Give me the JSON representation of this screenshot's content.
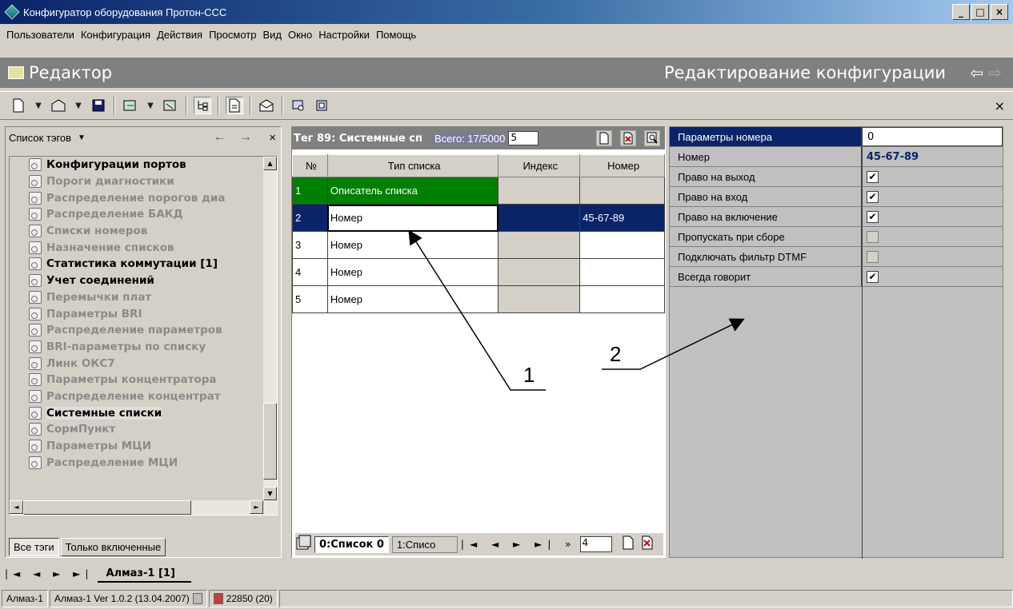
{
  "window": {
    "title": "Конфигуратор оборудования Протон-ССС",
    "buttons": [
      "_",
      "□",
      "×"
    ]
  },
  "menu": [
    "Пользователи",
    "Конфигурация",
    "Действия",
    "Просмотр",
    "Вид",
    "Окно",
    "Настройки",
    "Помощь"
  ],
  "editor": {
    "title": "Редактор",
    "subtitle": "Редактирование конфигурации",
    "back_arrow": "⇦",
    "forward_arrow": "⇨"
  },
  "toolbar": {
    "close": "×"
  },
  "left": {
    "header": "Список тэгов",
    "dropdown": "▼",
    "nav": "← →",
    "close": "×",
    "items": [
      {
        "label": "Конфигурации портов",
        "enabled": true
      },
      {
        "label": "Пороги диагностики",
        "enabled": false
      },
      {
        "label": "Распределение порогов диа",
        "enabled": false
      },
      {
        "label": "Распределение БАКД",
        "enabled": false
      },
      {
        "label": "Списки номеров",
        "enabled": false
      },
      {
        "label": "Назначение списков",
        "enabled": false
      },
      {
        "label": "Статистика коммутации [1]",
        "enabled": true
      },
      {
        "label": "Учет соединений",
        "enabled": true
      },
      {
        "label": "Перемычки плат",
        "enabled": false
      },
      {
        "label": "Параметры BRI",
        "enabled": false
      },
      {
        "label": "Распределение параметров",
        "enabled": false
      },
      {
        "label": "BRI-параметры по списку",
        "enabled": false
      },
      {
        "label": "Линк ОКС7",
        "enabled": false
      },
      {
        "label": "Параметры концентратора",
        "enabled": false
      },
      {
        "label": "Распределение концентрат",
        "enabled": false
      },
      {
        "label": "Системные списки",
        "enabled": true,
        "selected": true
      },
      {
        "label": "СормПункт",
        "enabled": false
      },
      {
        "label": "Параметры МЦИ",
        "enabled": false
      },
      {
        "label": "Распределение МЦИ",
        "enabled": false
      }
    ],
    "tabs": [
      "Все тэги",
      "Только включенные"
    ]
  },
  "middle": {
    "tag_title": "Тег 89: Системные сп",
    "total": "Всего: 17/5000",
    "count": "5",
    "columns": [
      "№",
      "Тип списка",
      "Индекс",
      "Номер"
    ],
    "rows": [
      {
        "n": "1",
        "type": "Описатель списка",
        "index": "",
        "number": ""
      },
      {
        "n": "2",
        "type": "Номер",
        "index": "",
        "number": "45-67-89"
      },
      {
        "n": "3",
        "type": "Номер",
        "index": "",
        "number": ""
      },
      {
        "n": "4",
        "type": "Номер",
        "index": "",
        "number": ""
      },
      {
        "n": "5",
        "type": "Номер",
        "index": "",
        "number": ""
      }
    ],
    "footer": {
      "tab_active": "0:Список 0",
      "tab_next": "1:Списо",
      "nav": "|◄ ◄ ► ►| »",
      "page": "4"
    }
  },
  "right": {
    "rows": [
      {
        "label": "Параметры номера",
        "value": "0",
        "kind": "input"
      },
      {
        "label": "Номер",
        "value": "45-67-89",
        "kind": "text"
      },
      {
        "label": "Право на выход",
        "checked": true,
        "kind": "check"
      },
      {
        "label": "Право на вход",
        "checked": true,
        "kind": "check"
      },
      {
        "label": "Право на включение",
        "checked": true,
        "kind": "check"
      },
      {
        "label": "Пропускать при сборе",
        "checked": false,
        "kind": "check"
      },
      {
        "label": "Подключать фильтр DTMF",
        "checked": false,
        "kind": "check"
      },
      {
        "label": "Всегда говорит",
        "checked": true,
        "kind": "check"
      }
    ],
    "check_mark": "✔"
  },
  "annotations": {
    "label1": "1",
    "label2": "2"
  },
  "bottom": {
    "nav": "|◄ ◄ ► ►|",
    "doc_tab": "Алмаз-1 [1]"
  },
  "status": {
    "device": "Алмаз-1",
    "version": "Алмаз-1 Ver 1.0.2 (13.04.2007)",
    "counter": "22850 (20)"
  }
}
